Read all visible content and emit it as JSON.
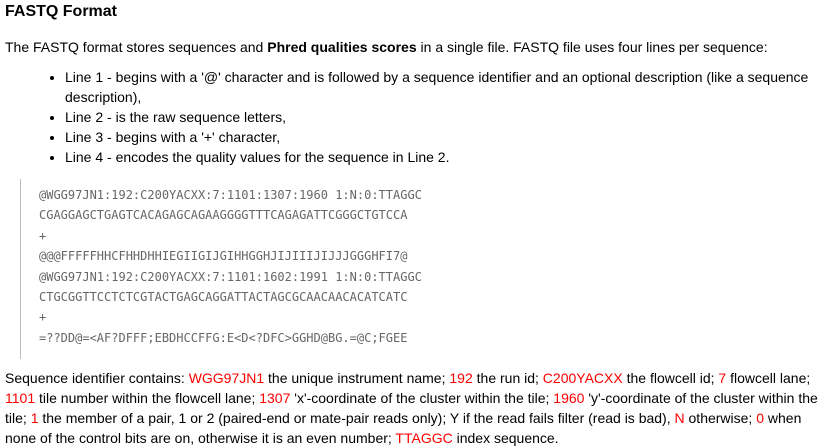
{
  "heading": "FASTQ Format",
  "intro": {
    "before": "The FASTQ format stores sequences and ",
    "bold": "Phred qualities scores",
    "after": " in a single file. FASTQ file uses four lines per sequence:"
  },
  "bullets": [
    "Line 1 - begins with a '@' character and is followed by a sequence identifier and an optional description (like a sequence description),",
    "Line 2 - is the raw sequence letters,",
    "Line 3 - begins with a '+' character,",
    "Line 4 - encodes the quality values for the sequence in Line 2."
  ],
  "code_lines": [
    "@WGG97JN1:192:C200YACXX:7:1101:1307:1960 1:N:0:TTAGGC",
    "CGAGGAGCTGAGTCACAGAGCAGAAGGGGTTTCAGAGATTCGGGCTGTCCA",
    "+",
    "@@@FFFFFHHCFHHDHHIEGIIGIJGIHHGGHJIJIIIJIJJJGGGHFI7@",
    "@WGG97JN1:192:C200YACXX:7:1101:1602:1991 1:N:0:TTAGGC",
    "CTGCGGTTCCTCTCGTACTGAGCAGGATTACTAGCGCAACAACACATCATC",
    "+",
    "=??DD@=<AF?DFFF;EBDHCCFFG:E<D<?DFC>GGHD@BG.=@C;FGEE"
  ],
  "description": {
    "t0": "Sequence identifier contains: ",
    "h0": "WGG97JN1",
    "t1": " the unique instrument name; ",
    "h1": "192",
    "t2": " the run id; ",
    "h2": "C200YACXX",
    "t3": " the flowcell id; ",
    "h3": "7",
    "t4": " flowcell lane; ",
    "h4": "1101",
    "t5": " tile number within the flowcell lane; ",
    "h5": "1307",
    "t6": " 'x'-coordinate of the cluster within the tile; ",
    "h6": "1960",
    "t7": " 'y'-coordinate of the cluster within the tile; ",
    "h7": "1",
    "t8": " the member of a pair, 1 or 2 (paired-end or mate-pair reads only); Y if the read fails filter (read is bad), ",
    "h8": "N",
    "t9": " otherwise; ",
    "h9": "0",
    "t10": " when none of the control bits are on, otherwise it is an even number; ",
    "h10": "TTAGGC",
    "t11": " index sequence."
  },
  "colors": {
    "highlight": "#ff0000",
    "code_text": "#666666",
    "code_border": "#bbbbbb"
  }
}
